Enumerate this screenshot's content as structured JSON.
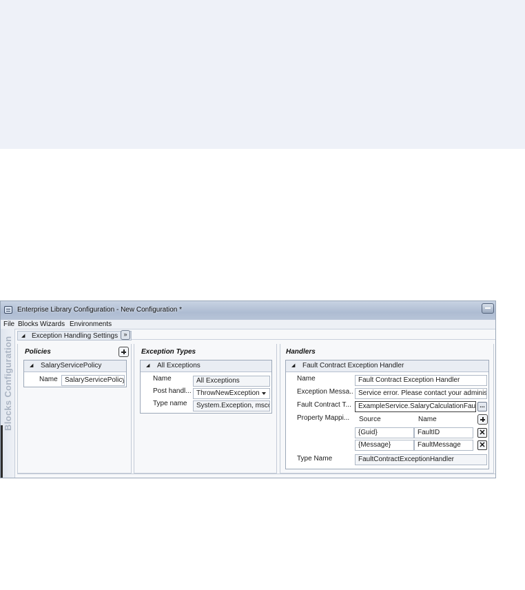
{
  "window": {
    "title": "Enterprise Library Configuration - New Configuration *"
  },
  "menu": [
    "File",
    "Blocks",
    "Wizards",
    "Environments"
  ],
  "side_label": "Blocks Configuration",
  "block": {
    "title": "Exception Handling Settings"
  },
  "policies": {
    "header": "Policies",
    "item": {
      "title": "SalaryServicePolicy",
      "name_label": "Name",
      "name_value": "SalaryServicePolicy"
    }
  },
  "exception_types": {
    "header": "Exception Types",
    "item": {
      "title": "All Exceptions",
      "name_label": "Name",
      "name_value": "All Exceptions",
      "post_label": "Post handl...",
      "post_value": "ThrowNewException",
      "type_label": "Type name",
      "type_value": "System.Exception, msco"
    }
  },
  "handlers": {
    "header": "Handlers",
    "item": {
      "title": "Fault Contract Exception Handler",
      "name_label": "Name",
      "name_value": "Fault Contract Exception Handler",
      "message_label": "Exception Messa...",
      "message_value": "Service error. Please contact your adminis",
      "fault_label": "Fault Contract T...",
      "fault_value": "ExampleService.SalaryCalculationFault,",
      "mapping_label": "Property Mappi...",
      "mapping_columns": [
        "Source",
        "Name"
      ],
      "mappings": [
        {
          "source": "{Guid}",
          "name": "FaultID"
        },
        {
          "source": "{Message}",
          "name": "FaultMessage"
        }
      ],
      "type_label": "Type Name",
      "type_value": "FaultContractExceptionHandler"
    }
  }
}
